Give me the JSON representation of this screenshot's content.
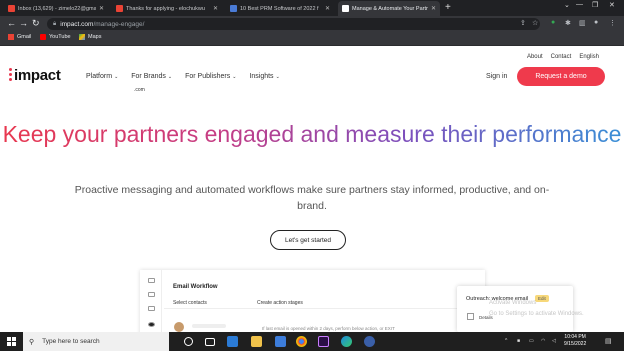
{
  "browser": {
    "tabs": [
      {
        "title": "Inbox (13,629) - zimelo22@gma",
        "favicon_color": "#ea4335",
        "active": false
      },
      {
        "title": "Thanks for applying - elochukwu",
        "favicon_color": "#ea4335",
        "active": false
      },
      {
        "title": "10 Best PRM Software of 2022 f",
        "favicon_color": "#4a7bd6",
        "active": false
      },
      {
        "title": "Manage & Automate Your Partne",
        "favicon_color": "#ffffff",
        "active": true
      }
    ],
    "new_tab": "+",
    "url_host": "impact.com",
    "url_path": "/manage-engage/",
    "bookmarks": [
      {
        "label": "Gmail",
        "icon": "gmail-icon"
      },
      {
        "label": "YouTube",
        "icon": "youtube-icon"
      },
      {
        "label": "Maps",
        "icon": "maps-icon"
      }
    ]
  },
  "site": {
    "toplinks": [
      "About",
      "Contact",
      "English"
    ],
    "logo_text": "impact",
    "logo_sub": ".com",
    "nav": [
      "Platform",
      "For Brands",
      "For Publishers",
      "Insights"
    ],
    "signin": "Sign in",
    "demo_button": "Request a demo",
    "headline": "Keep your partners engaged and measure their performance",
    "subhead": "Proactive messaging and automated workflows make sure partners stay informed, productive, and on-brand.",
    "cta": "Let's get started",
    "accent_color": "#ef3a4c"
  },
  "preview": {
    "title": "Email Workflow",
    "col1": "Select contacts",
    "col2": "Create action stages",
    "note": "If last email is opened within 2 days, perform below action, or EXIT",
    "card_title": "Outreach: welcome email",
    "card_badge": "Edit",
    "card_details": "Details"
  },
  "watermark": {
    "line1": "Activate Windows",
    "line2": "Go to Settings to activate Windows."
  },
  "taskbar": {
    "search_placeholder": "Type here to search",
    "time": "10:04 PM",
    "date": "9/15/2022"
  }
}
